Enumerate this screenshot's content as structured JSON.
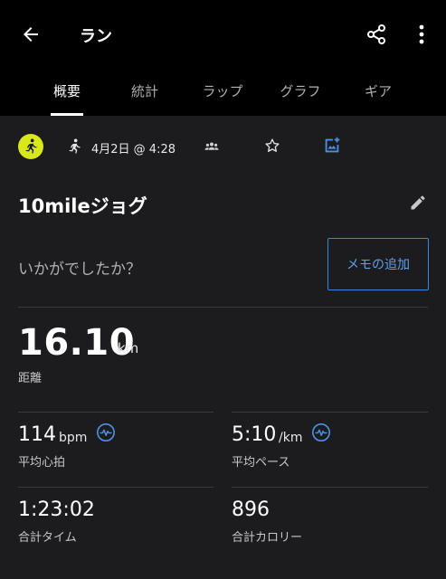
{
  "header": {
    "title": "ラン",
    "icons": {
      "back": "arrow-back-icon",
      "share": "share-icon",
      "more": "more-vert-icon"
    }
  },
  "tabs": [
    {
      "label": "概要",
      "active": true
    },
    {
      "label": "統計",
      "active": false
    },
    {
      "label": "ラップ",
      "active": false
    },
    {
      "label": "グラフ",
      "active": false
    },
    {
      "label": "ギア",
      "active": false
    }
  ],
  "info": {
    "date": "4月2日 @ 4:28",
    "icons": [
      "runner-avatar-icon",
      "run-icon",
      "group-icon",
      "star-icon",
      "add-photo-icon"
    ]
  },
  "activity": {
    "name": "10mileジョグ",
    "notes_prompt": "いかがでしたか？",
    "memo_button": "メモの追加"
  },
  "stats": {
    "distance": {
      "value": "16.10",
      "unit": "km",
      "label": "距離"
    },
    "heart_rate": {
      "value": "114",
      "unit": "bpm",
      "label": "平均心拍"
    },
    "pace": {
      "value": "5:10",
      "unit": "/km",
      "label": "平均ペース"
    },
    "time": {
      "value": "1:23:02",
      "label": "合計タイム"
    },
    "calories": {
      "value": "896",
      "label": "合計カロリー"
    }
  },
  "colors": {
    "background": "#1c1c1e",
    "bar": "#000000",
    "accent_blue": "#3d86d6",
    "avatar_yellow": "#d9e81c",
    "divider": "#3a3a3c"
  }
}
